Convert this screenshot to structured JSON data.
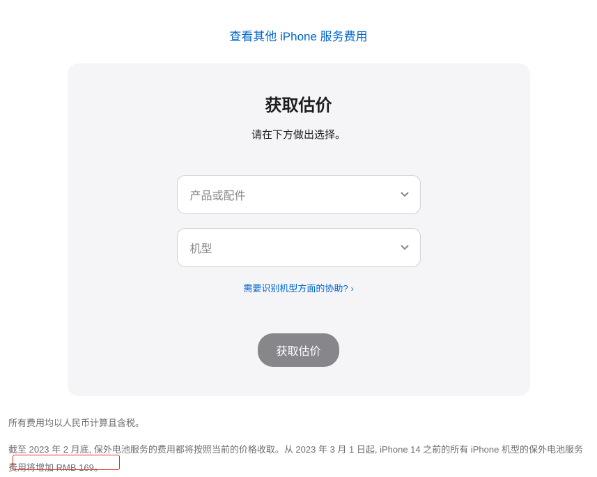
{
  "top_link": "查看其他 iPhone 服务费用",
  "card": {
    "title": "获取估价",
    "subtitle": "请在下方做出选择。",
    "select_product_placeholder": "产品或配件",
    "select_model_placeholder": "机型",
    "help_link": "需要识别机型方面的协助?",
    "button_label": "获取估价"
  },
  "footer": {
    "tax_note": "所有费用均以人民币计算且含税。",
    "price_note": "截至 2023 年 2 月底, 保外电池服务的费用都将按照当前的价格收取。从 2023 年 3 月 1 日起, iPhone 14 之前的所有 iPhone 机型的保外电池服务费用将增加 RMB 169。"
  }
}
